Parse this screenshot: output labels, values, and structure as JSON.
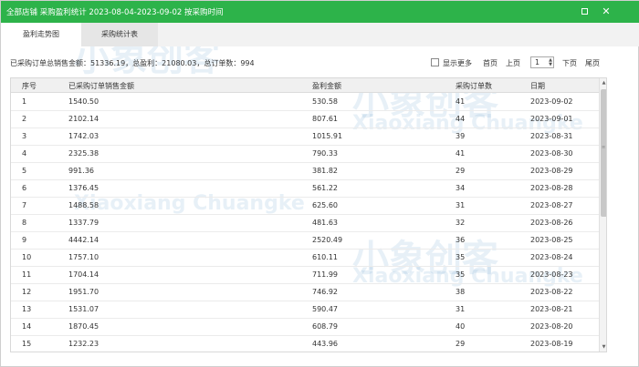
{
  "window": {
    "title": "全部店铺 采购盈利统计 2023-08-04-2023-09-02 按采购时间",
    "max_icon": "maximize-icon",
    "close_icon": "close-icon",
    "accent": "#2db34a"
  },
  "tabs": [
    {
      "label": "盈利走势图"
    },
    {
      "label": "采购统计表"
    }
  ],
  "summary": "已采购订单总销售金额：51336.19，总盈利：21080.03，总订单数：994",
  "toolbar": {
    "show_more": "显示更多",
    "first": "首页",
    "prev": "上页",
    "page": "1",
    "next": "下页",
    "last": "尾页"
  },
  "table": {
    "headers": [
      "序号",
      "已采购订单销售金额",
      "盈利金额",
      "采购订单数",
      "日期"
    ],
    "rows": [
      [
        "1",
        "1540.50",
        "530.58",
        "41",
        "2023-09-02"
      ],
      [
        "2",
        "2102.14",
        "807.61",
        "44",
        "2023-09-01"
      ],
      [
        "3",
        "1742.03",
        "1015.91",
        "39",
        "2023-08-31"
      ],
      [
        "4",
        "2325.38",
        "790.33",
        "41",
        "2023-08-30"
      ],
      [
        "5",
        "991.36",
        "381.82",
        "29",
        "2023-08-29"
      ],
      [
        "6",
        "1376.45",
        "561.22",
        "34",
        "2023-08-28"
      ],
      [
        "7",
        "1488.58",
        "625.60",
        "31",
        "2023-08-27"
      ],
      [
        "8",
        "1337.79",
        "481.63",
        "32",
        "2023-08-26"
      ],
      [
        "9",
        "4442.14",
        "2520.49",
        "36",
        "2023-08-25"
      ],
      [
        "10",
        "1757.10",
        "610.11",
        "35",
        "2023-08-24"
      ],
      [
        "11",
        "1704.14",
        "711.99",
        "35",
        "2023-08-23"
      ],
      [
        "12",
        "1951.70",
        "746.92",
        "38",
        "2023-08-22"
      ],
      [
        "13",
        "1531.07",
        "590.47",
        "31",
        "2023-08-21"
      ],
      [
        "14",
        "1870.45",
        "608.79",
        "40",
        "2023-08-20"
      ],
      [
        "15",
        "1232.23",
        "443.96",
        "29",
        "2023-08-19"
      ]
    ]
  },
  "watermark": {
    "brand": "小象创客",
    "latin": "Xiaoxiang Chuangke"
  }
}
